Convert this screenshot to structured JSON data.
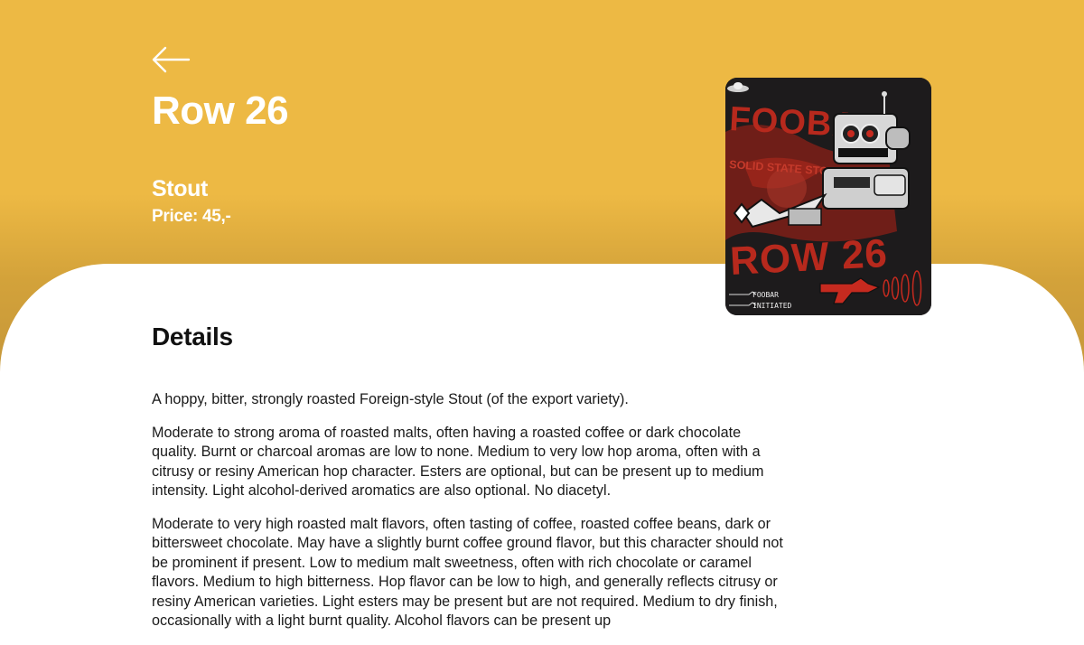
{
  "header": {
    "back_icon": "arrow-left-icon",
    "title": "Row 26",
    "style": "Stout",
    "price_label": "Price:",
    "price_value": "45,-",
    "background_color": "#edb944"
  },
  "label_image": {
    "brand_title": "FOOBAR",
    "subtitle": "SOLID STATE STOUT",
    "name": "ROW 26",
    "footer_line1": "FOOBAR",
    "footer_line2": "INITIATED",
    "accent_color": "#b7291d"
  },
  "details": {
    "heading": "Details",
    "paragraphs": [
      "A hoppy, bitter, strongly roasted Foreign-style Stout (of the export variety).",
      "Moderate to strong aroma of roasted malts, often having a roasted coffee or dark chocolate quality. Burnt or charcoal aromas are low to none. Medium to very low hop aroma, often with a citrusy or resiny American hop character. Esters are optional, but can be present up to medium intensity. Light alcohol-derived aromatics are also optional. No diacetyl.",
      "Moderate to very high roasted malt flavors, often tasting of coffee, roasted coffee beans, dark or bittersweet chocolate. May have a slightly burnt coffee ground flavor, but this character should not be prominent if present. Low to medium malt sweetness, often with rich chocolate or caramel flavors. Medium to high bitterness. Hop flavor can be low to high, and generally reflects citrusy or resiny American varieties. Light esters may be present but are not required. Medium to dry finish, occasionally with a light burnt quality. Alcohol flavors can be present up"
    ]
  }
}
